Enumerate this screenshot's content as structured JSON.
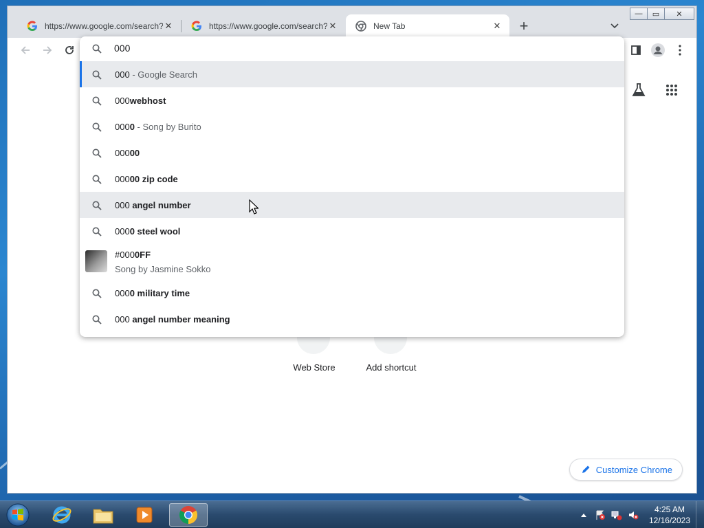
{
  "browser": {
    "tabs": [
      {
        "title": "https://www.google.com/search?q=",
        "active": false
      },
      {
        "title": "https://www.google.com/search?q=",
        "active": false
      },
      {
        "title": "New Tab",
        "active": true
      }
    ],
    "new_tab_symbol": "+",
    "close_symbol": "✕",
    "window_controls": {
      "minimize": "—",
      "maximize": "▭",
      "close": "✕"
    }
  },
  "omnibox": {
    "value": "000",
    "suggestions": [
      {
        "prefix": "000",
        "bold": "",
        "suffix": " - Google Search",
        "state": "selected"
      },
      {
        "prefix": "000",
        "bold": "webhost",
        "suffix": "",
        "state": ""
      },
      {
        "prefix": "000",
        "bold": "0",
        "suffix": " - Song by Burito",
        "state": ""
      },
      {
        "prefix": "000",
        "bold": "00",
        "suffix": "",
        "state": ""
      },
      {
        "prefix": "000",
        "bold": "00 zip code",
        "suffix": "",
        "state": ""
      },
      {
        "prefix": "000",
        "bold": " angel number",
        "suffix": "",
        "state": "hover"
      },
      {
        "prefix": "000",
        "bold": "0 steel wool",
        "suffix": "",
        "state": ""
      },
      {
        "prefix": "#000",
        "bold": "0FF",
        "suffix": "",
        "subtitle": "Song by Jasmine Sokko",
        "state": "rich"
      },
      {
        "prefix": "000",
        "bold": "0 military time",
        "suffix": "",
        "state": ""
      },
      {
        "prefix": "000",
        "bold": " angel number meaning",
        "suffix": "",
        "state": ""
      }
    ]
  },
  "new_tab_page": {
    "shortcuts": [
      {
        "label": "Web Store"
      },
      {
        "label": "Add shortcut"
      }
    ],
    "customize_label": "Customize Chrome"
  },
  "taskbar": {
    "time": "4:25 AM",
    "date": "12/16/2023"
  },
  "colors": {
    "accent": "#1a73e8",
    "selected_row": "#e8eaed",
    "taskbar": "#2a4a6e"
  }
}
